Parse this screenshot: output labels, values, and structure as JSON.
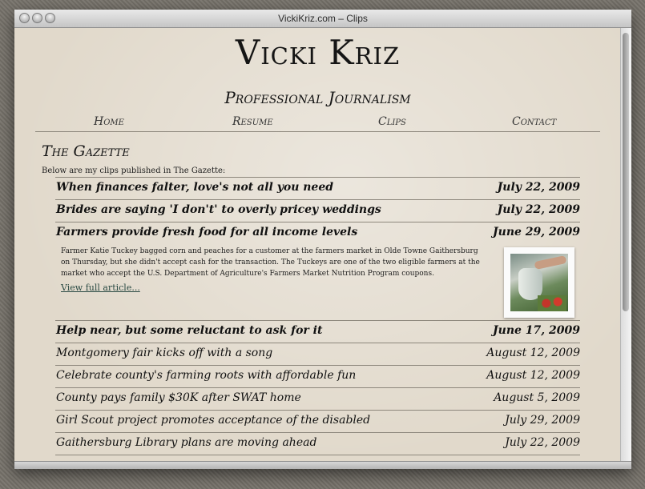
{
  "window": {
    "title": "VickiKriz.com – Clips"
  },
  "site": {
    "title": "Vicki Kriz",
    "subtitle": "Professional Journalism"
  },
  "nav": [
    "Home",
    "Resume",
    "Clips",
    "Contact"
  ],
  "section": {
    "title": "The Gazette",
    "intro": "Below are my clips published in The Gazette:"
  },
  "clips": [
    {
      "title": "When finances falter, love's not all you need",
      "date": "July 22, 2009"
    },
    {
      "title": "Brides are saying 'I don't' to overly pricey weddings",
      "date": "July 22, 2009"
    },
    {
      "title": "Farmers provide fresh food for all income levels",
      "date": "June 29, 2009",
      "summary": "Farmer Katie Tuckey bagged corn and peaches for a customer at the farmers market in Olde Towne Gaithersburg on Thursday, but she didn't accept cash for the transaction. The Tuckeys are one of the two eligible farmers at the market who accept the U.S. Department of Agriculture's Farmers Market Nutrition Program coupons.",
      "link": "View full article..."
    },
    {
      "title": "Help near, but some reluctant to ask for it",
      "date": "June 17, 2009"
    },
    {
      "title": "Montgomery fair kicks off with a song",
      "date": "August 12, 2009"
    },
    {
      "title": "Celebrate county's farming roots with affordable fun",
      "date": "August 12, 2009"
    },
    {
      "title": "County pays family $30K after SWAT home",
      "date": "August 5, 2009"
    },
    {
      "title": "Girl Scout project promotes acceptance of the disabled",
      "date": "July 29, 2009"
    },
    {
      "title": "Gaithersburg Library plans are moving ahead",
      "date": "July 22, 2009"
    }
  ]
}
